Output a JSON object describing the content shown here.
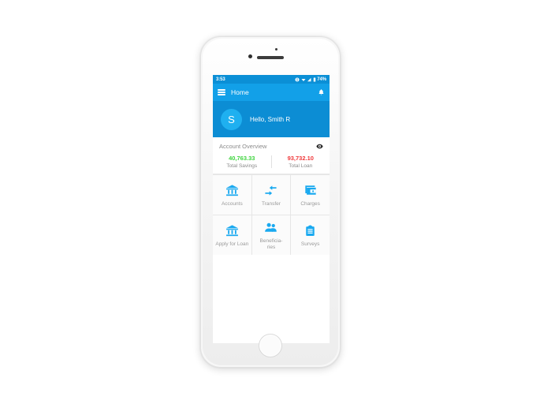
{
  "device": {
    "frame": "iphone-white",
    "home_button": "home-button"
  },
  "status_bar": {
    "time": "3:53",
    "battery_text": "74%",
    "icons": [
      "location-icon",
      "wifi-icon",
      "signal-icon",
      "battery-icon"
    ]
  },
  "app_bar": {
    "menu_icon": "hamburger-menu-icon",
    "title": "Home",
    "notification_icon": "bell-icon",
    "background": "#12a0e8"
  },
  "profile": {
    "avatar_initial": "S",
    "greeting": "Hello, Smith R",
    "background": "#0c8dd4",
    "avatar_color": "#1fb0f0"
  },
  "account_overview": {
    "title": "Account Overview",
    "toggle_icon": "eye-visibility-icon",
    "stats": [
      {
        "value": "40,763.33",
        "label": "Total Savings",
        "color": "#3fd43f"
      },
      {
        "value": "93,732.10",
        "label": "Total Loan",
        "color": "#f0383a"
      }
    ]
  },
  "tiles": [
    {
      "label": "Accounts",
      "icon": "bank-icon"
    },
    {
      "label": "Transfer",
      "icon": "transfer-arrows-icon"
    },
    {
      "label": "Charges",
      "icon": "wallet-icon"
    },
    {
      "label": "Apply for Loan",
      "icon": "bank-icon"
    },
    {
      "label": "Beneficia-\nries",
      "icon": "people-icon"
    },
    {
      "label": "Surveys",
      "icon": "clipboard-icon"
    }
  ],
  "theme": {
    "accent": "#12a0e8",
    "accent_dark": "#0c8dd4",
    "status_bar": "#0b8fd6",
    "icon_blue": "#19a9f0",
    "muted_text": "#9a9a9a"
  }
}
